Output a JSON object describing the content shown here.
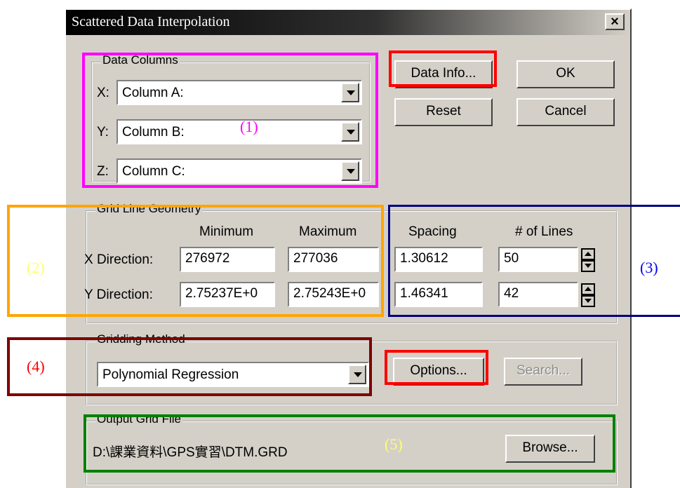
{
  "window": {
    "title": "Scattered Data Interpolation",
    "close": "×"
  },
  "data_columns": {
    "label": "Data Columns",
    "x_label": "X:",
    "x_value": "Column A:",
    "y_label": "Y:",
    "y_value": "Column B:",
    "z_label": "Z:",
    "z_value": "Column C:"
  },
  "buttons": {
    "data_info": "Data Info...",
    "ok": "OK",
    "reset": "Reset",
    "cancel": "Cancel",
    "options": "Options...",
    "search": "Search...",
    "browse": "Browse..."
  },
  "grid": {
    "label": "Grid Line Geometry",
    "col_min": "Minimum",
    "col_max": "Maximum",
    "col_spacing": "Spacing",
    "col_lines": "# of Lines",
    "x_label": "X Direction:",
    "x_min": "276972",
    "x_max": "277036",
    "x_spacing": "1.30612",
    "x_lines": "50",
    "y_label": "Y Direction:",
    "y_min": "2.75237E+0",
    "y_max": "2.75243E+0",
    "y_spacing": "1.46341",
    "y_lines": "42"
  },
  "gridding": {
    "label": "Gridding Method",
    "value": "Polynomial Regression"
  },
  "output": {
    "label": "Output Grid File",
    "path": "D:\\課業資料\\GPS實習\\DTM.GRD"
  },
  "annotations": {
    "a1": "(1)",
    "a2": "(2)",
    "a3": "(3)",
    "a4": "(4)",
    "a5": "(5)",
    "colors": {
      "magenta": "#ff00ff",
      "orange": "#ffa500",
      "navy": "#000080",
      "darkred": "#800000",
      "green": "#008000",
      "red": "#ff0000",
      "yellow": "#ffff66",
      "blue": "#0000ff"
    }
  }
}
